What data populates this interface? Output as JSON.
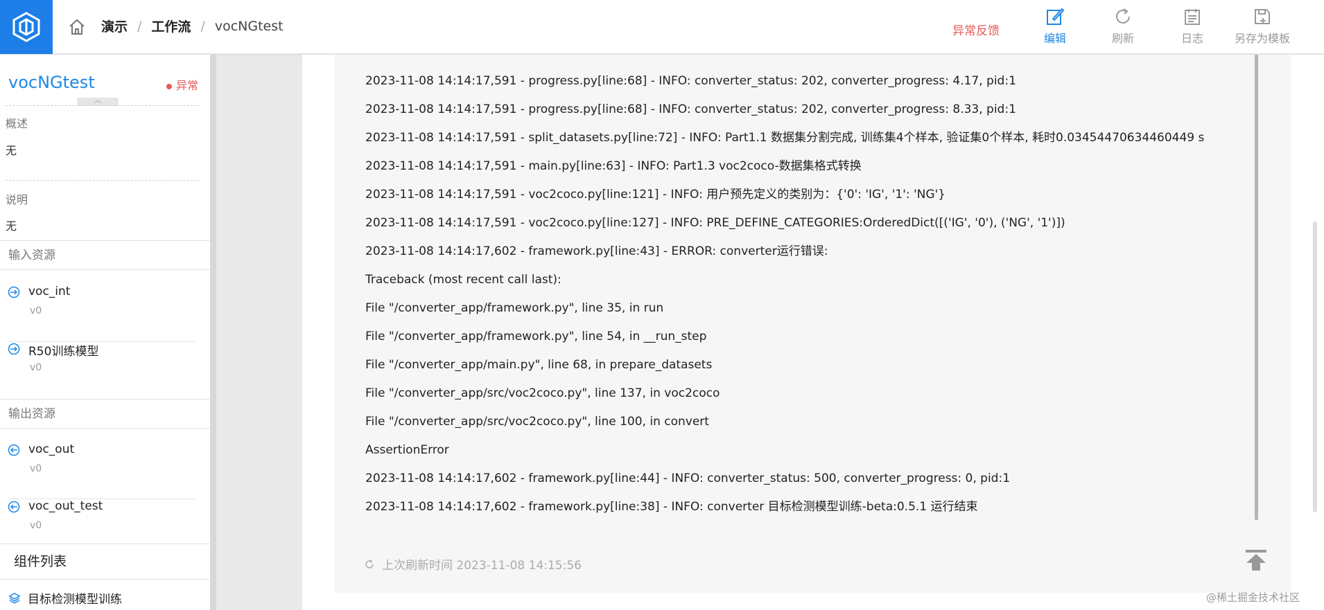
{
  "header": {
    "breadcrumb": [
      "演示",
      "工作流",
      "vocNGtest"
    ],
    "feedback_label": "异常反馈",
    "tools": [
      {
        "label": "编辑",
        "icon": "edit-icon",
        "active": true
      },
      {
        "label": "刷新",
        "icon": "refresh-icon",
        "active": false
      },
      {
        "label": "日志",
        "icon": "log-icon",
        "active": false
      },
      {
        "label": "另存为模板",
        "icon": "save-template-icon",
        "active": false
      }
    ]
  },
  "sidebar": {
    "title": "vocNGtest",
    "status": "异常",
    "overview_label": "概述",
    "overview_value": "无",
    "desc_label": "说明",
    "desc_value": "无",
    "input_label": "输入资源",
    "inputs": [
      {
        "name": "voc_int",
        "version": "v0"
      },
      {
        "name": "R50训练模型",
        "version": "v0"
      }
    ],
    "output_label": "输出资源",
    "outputs": [
      {
        "name": "voc_out",
        "version": "v0"
      },
      {
        "name": "voc_out_test",
        "version": "v0"
      }
    ],
    "component_label": "组件列表",
    "components": [
      "目标检测模型训练"
    ]
  },
  "log": {
    "lines": [
      "2023-11-08 14:14:17,591 - progress.py[line:68] - INFO: converter_status: 202, converter_progress: 4.17, pid:1",
      "2023-11-08 14:14:17,591 - progress.py[line:68] - INFO: converter_status: 202, converter_progress: 8.33, pid:1",
      "2023-11-08 14:14:17,591 - split_datasets.py[line:72] - INFO: Part1.1 数据集分割完成, 训练集4个样本, 验证集0个样本, 耗时0.03454470634460449 s",
      "2023-11-08 14:14:17,591 - main.py[line:63] - INFO: Part1.3 voc2coco-数据集格式转换",
      "2023-11-08 14:14:17,591 - voc2coco.py[line:121] - INFO: 用户预先定义的类别为：{'0': 'IG', '1': 'NG'}",
      "2023-11-08 14:14:17,591 - voc2coco.py[line:127] - INFO: PRE_DEFINE_CATEGORIES:OrderedDict([('IG', '0'), ('NG', '1')])",
      "2023-11-08 14:14:17,602 - framework.py[line:43] - ERROR: converter运行错误:",
      "Traceback (most recent call last):",
      "File \"/converter_app/framework.py\", line 35, in run",
      "File \"/converter_app/framework.py\", line 54, in __run_step",
      "File \"/converter_app/main.py\", line 68, in prepare_datasets",
      "File \"/converter_app/src/voc2coco.py\", line 137, in voc2coco",
      "File \"/converter_app/src/voc2coco.py\", line 100, in convert",
      "AssertionError",
      "2023-11-08 14:14:17,602 - framework.py[line:44] - INFO: converter_status: 500, converter_progress: 0, pid:1",
      "2023-11-08 14:14:17,602 - framework.py[line:38] - INFO: converter 目标检测模型训练-beta:0.5.1 运行结束"
    ],
    "refresh_text": "上次刷新时间 2023-11-08 14:15:56"
  },
  "watermark": "@稀土掘金技术社区",
  "colors": {
    "accent": "#1e88e5",
    "error": "#e85a5a",
    "logo_bg": "#1e7ee8"
  }
}
